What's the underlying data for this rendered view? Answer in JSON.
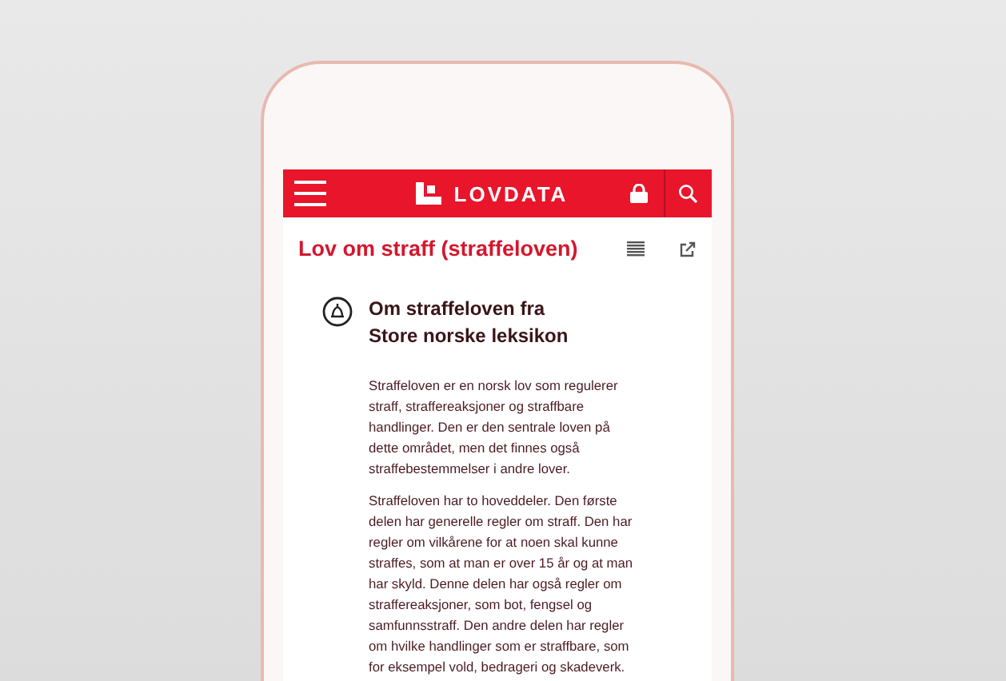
{
  "app_bar": {
    "logo_text": "LOVDATA"
  },
  "document": {
    "title": "Lov om straff (straffeloven)"
  },
  "article": {
    "heading_lines": [
      "Om straffeloven fra",
      "Store norske leksikon"
    ],
    "paragraphs": [
      [
        "Straffeloven er en norsk lov som regulerer",
        "straff, straffereaksjoner og straffbare",
        "handlinger. Den er den sentrale loven på",
        "dette området, men det finnes også",
        "straffebestemmelser i andre lover."
      ],
      [
        "Straffeloven har to hoveddeler. Den første",
        "delen har generelle regler om straff. Den har",
        "regler om vilkårene for at noen skal kunne",
        "straffes, som at man er over 15 år og at man",
        "har skyld. Denne delen har også regler om",
        "straffereaksjoner, som bot, fengsel og",
        "samfunnsstraff. Den andre delen har regler",
        "om hvilke handlinger som er straffbare, som",
        "for eksempel vold, bedrageri og skadeverk."
      ]
    ]
  }
}
